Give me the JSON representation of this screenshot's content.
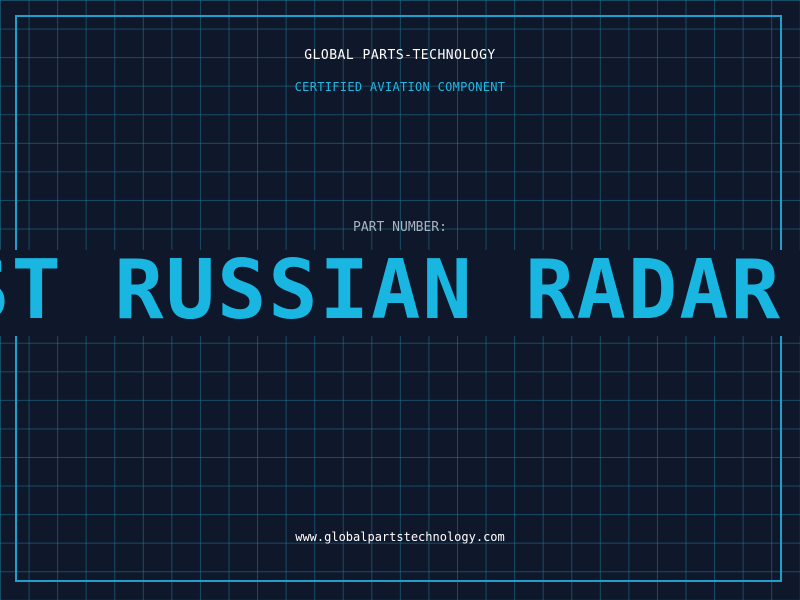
{
  "header": {
    "company": "GLOBAL PARTS-TECHNOLOGY",
    "subtitle": "CERTIFIED AVIATION COMPONENT"
  },
  "part": {
    "label": "PART NUMBER:",
    "number": "NEWEST RUSSIAN RADAR"
  },
  "footer": {
    "website": "www.globalpartstechnology.com"
  },
  "colors": {
    "background": "#0f172b",
    "grid": "#1e7896",
    "accent": "#1ab6e2",
    "text": "#ffffff"
  }
}
